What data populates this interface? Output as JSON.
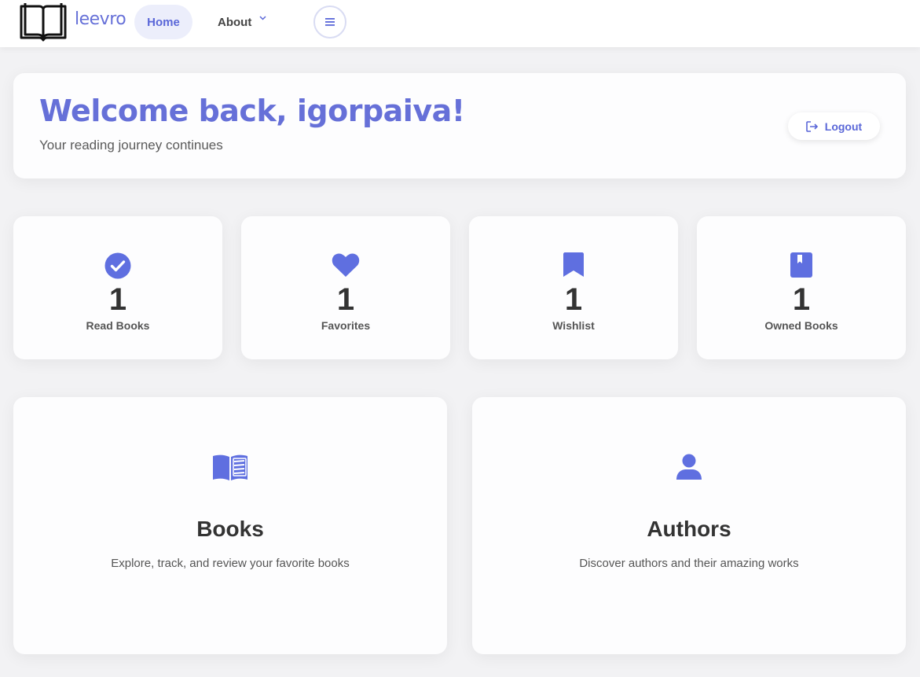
{
  "navbar": {
    "logo_text": "leevro",
    "home_label": "Home",
    "about_label": "About",
    "about_chevron": "˅"
  },
  "welcome": {
    "title": "Welcome back, igorpaiva!",
    "subtitle": "Your reading journey continues",
    "logout_label": "Logout"
  },
  "stats": [
    {
      "icon": "check-circle-icon",
      "value": "1",
      "label": "Read Books"
    },
    {
      "icon": "heart-icon",
      "value": "1",
      "label": "Favorites"
    },
    {
      "icon": "bookmark-icon",
      "value": "1",
      "label": "Wishlist"
    },
    {
      "icon": "book-icon",
      "value": "1",
      "label": "Owned Books"
    }
  ],
  "features": [
    {
      "icon": "open-book-icon",
      "title": "Books",
      "description": "Explore, track, and review your favorite books"
    },
    {
      "icon": "user-icon",
      "title": "Authors",
      "description": "Discover authors and their amazing works"
    }
  ],
  "colors": {
    "accent": "#5a67d8",
    "title": "#6670d8",
    "icon": "#5f6fe0",
    "background": "#f2f2f4"
  }
}
